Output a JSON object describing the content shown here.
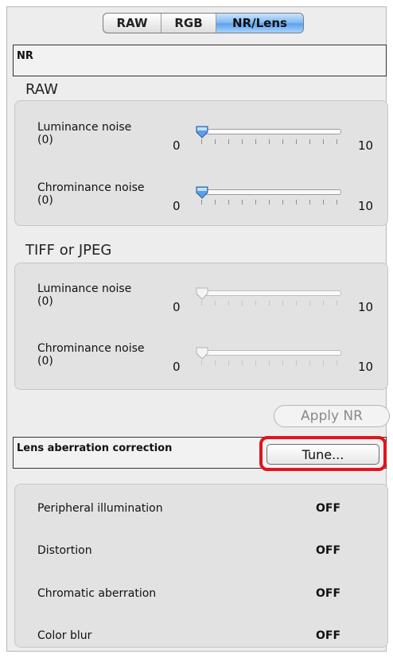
{
  "tabs": [
    {
      "label": "RAW",
      "active": false
    },
    {
      "label": "RGB",
      "active": false
    },
    {
      "label": "NR/Lens",
      "active": true
    }
  ],
  "nr": {
    "header": "NR",
    "raw": {
      "title": "RAW",
      "luminance": {
        "label_line1": "Luminance noise",
        "label_line2": "(0)",
        "min": "0",
        "max": "10",
        "value": 0
      },
      "chrominance": {
        "label_line1": "Chrominance noise",
        "label_line2": "(0)",
        "min": "0",
        "max": "10",
        "value": 0
      }
    },
    "tiff": {
      "title": "TIFF or JPEG",
      "luminance": {
        "label_line1": "Luminance noise",
        "label_line2": "(0)",
        "min": "0",
        "max": "10",
        "value": 0
      },
      "chrominance": {
        "label_line1": "Chrominance noise",
        "label_line2": "(0)",
        "min": "0",
        "max": "10",
        "value": 0
      }
    },
    "apply_button": "Apply NR"
  },
  "lens": {
    "header": "Lens aberration correction",
    "tune_button": "Tune...",
    "items": [
      {
        "label": "Peripheral illumination",
        "value": "OFF"
      },
      {
        "label": "Distortion",
        "value": "OFF"
      },
      {
        "label": "Chromatic aberration",
        "value": "OFF"
      },
      {
        "label": "Color blur",
        "value": "OFF"
      }
    ]
  },
  "colors": {
    "highlight": "#e1141e",
    "accent": "#5fa3ec"
  }
}
